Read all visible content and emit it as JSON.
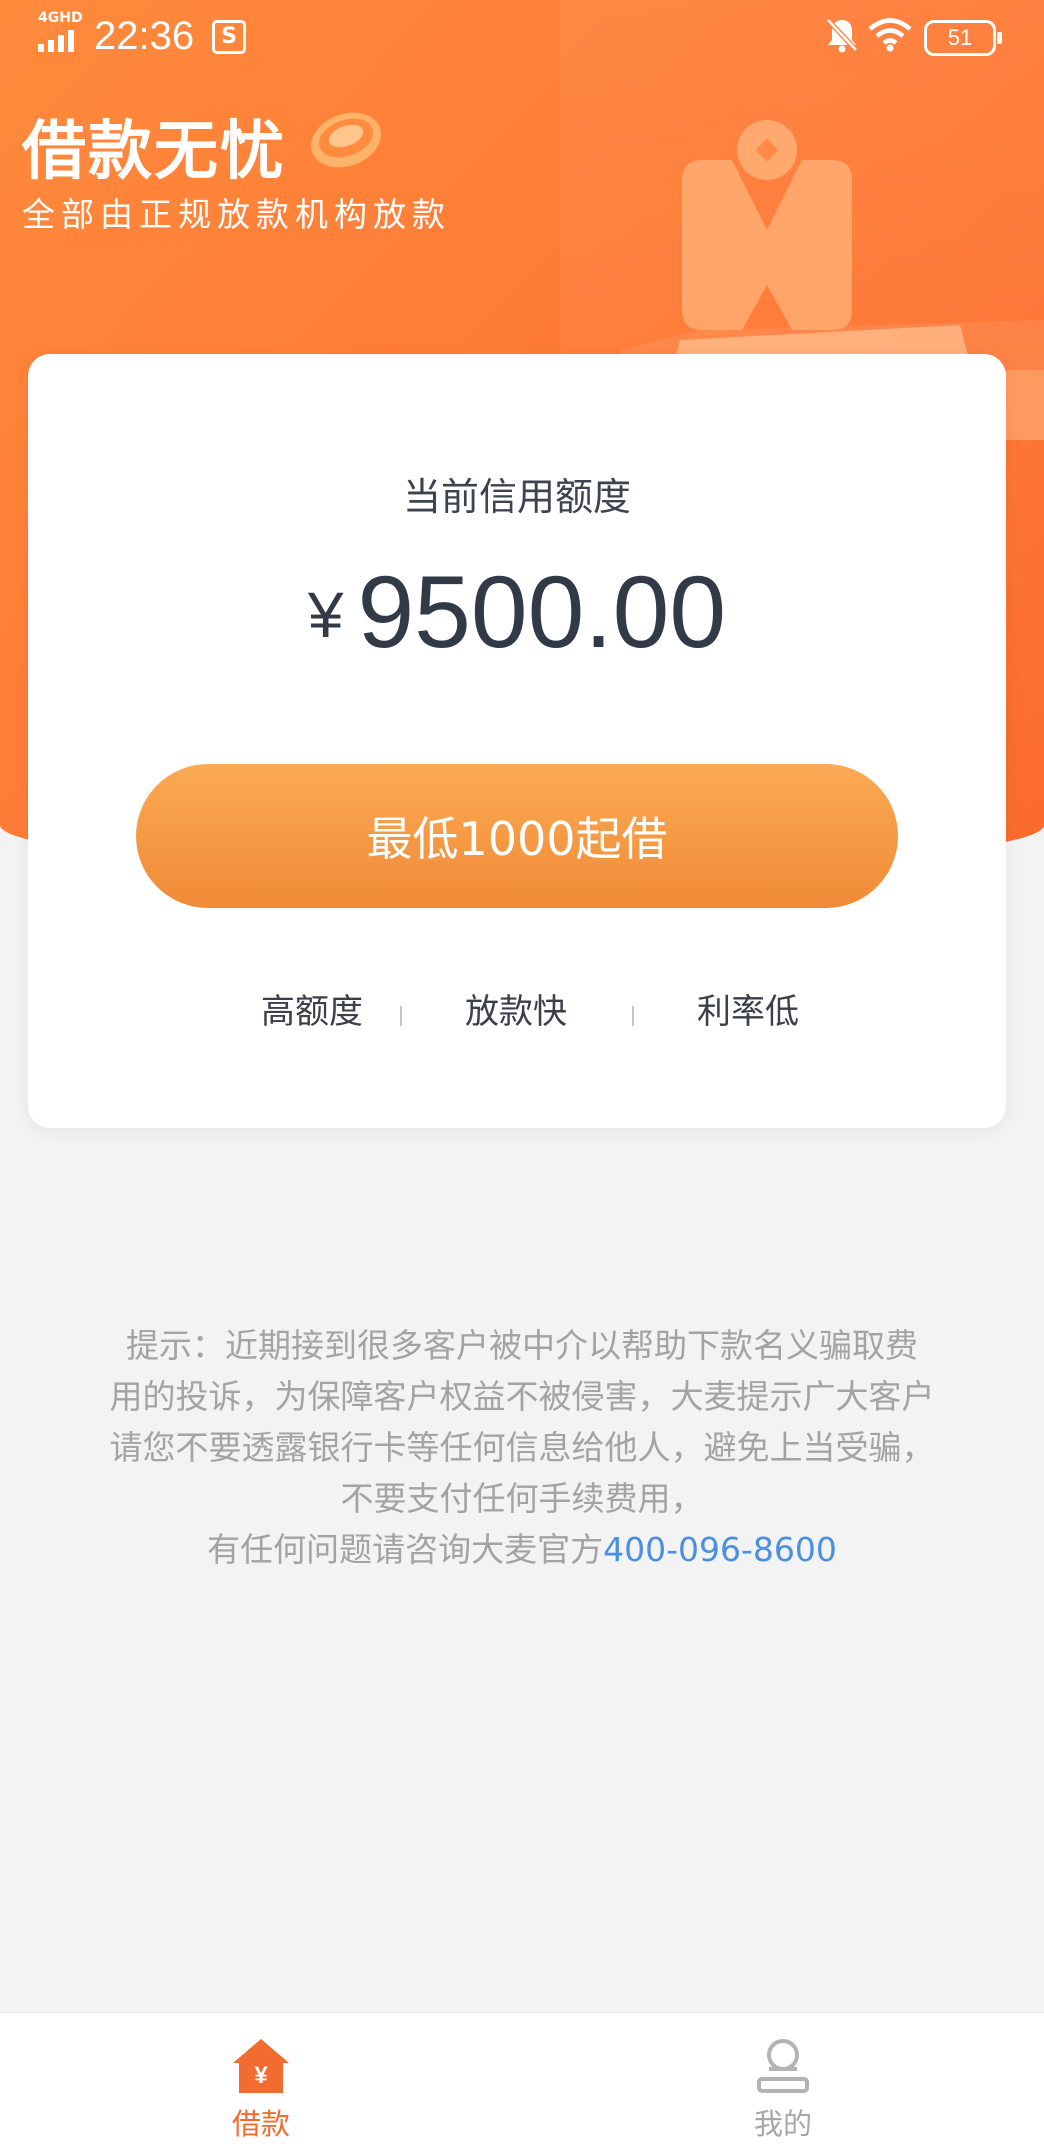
{
  "status_bar": {
    "network": "4GHD",
    "time": "22:36",
    "app_icon": "S",
    "battery": "51",
    "icons": [
      "signal-icon",
      "s-app-icon",
      "bell-muted-icon",
      "wifi-icon",
      "battery-icon"
    ]
  },
  "header": {
    "title": "借款无忧",
    "subtitle": "全部由正规放款机构放款"
  },
  "credit_card": {
    "title": "当前信用额度",
    "currency": "¥",
    "amount": "9500.00",
    "cta_label": "最低1000起借",
    "features": [
      "高额度",
      "放款快",
      "利率低"
    ]
  },
  "notice": {
    "line1": "提示：近期接到很多客户被中介以帮助下款名义骗取费",
    "line2": "用的投诉，为保障客户权益不被侵害，大麦提示广大客户",
    "line3": "请您不要透露银行卡等任何信息给他人，避免上当受骗，",
    "line4": "不要支付任何手续费用，",
    "line5_prefix": "有任何问题请咨询大麦官方",
    "phone": "400-096-8600"
  },
  "tabbar": {
    "tabs": [
      {
        "label": "借款",
        "icon": "home-yen-icon",
        "active": true
      },
      {
        "label": "我的",
        "icon": "person-icon",
        "active": false
      }
    ]
  },
  "colors": {
    "brand_orange": "#ff7a35",
    "cta_orange": "#f49a45",
    "active_tab": "#f26b2f",
    "link_blue": "#4a8fe0"
  }
}
